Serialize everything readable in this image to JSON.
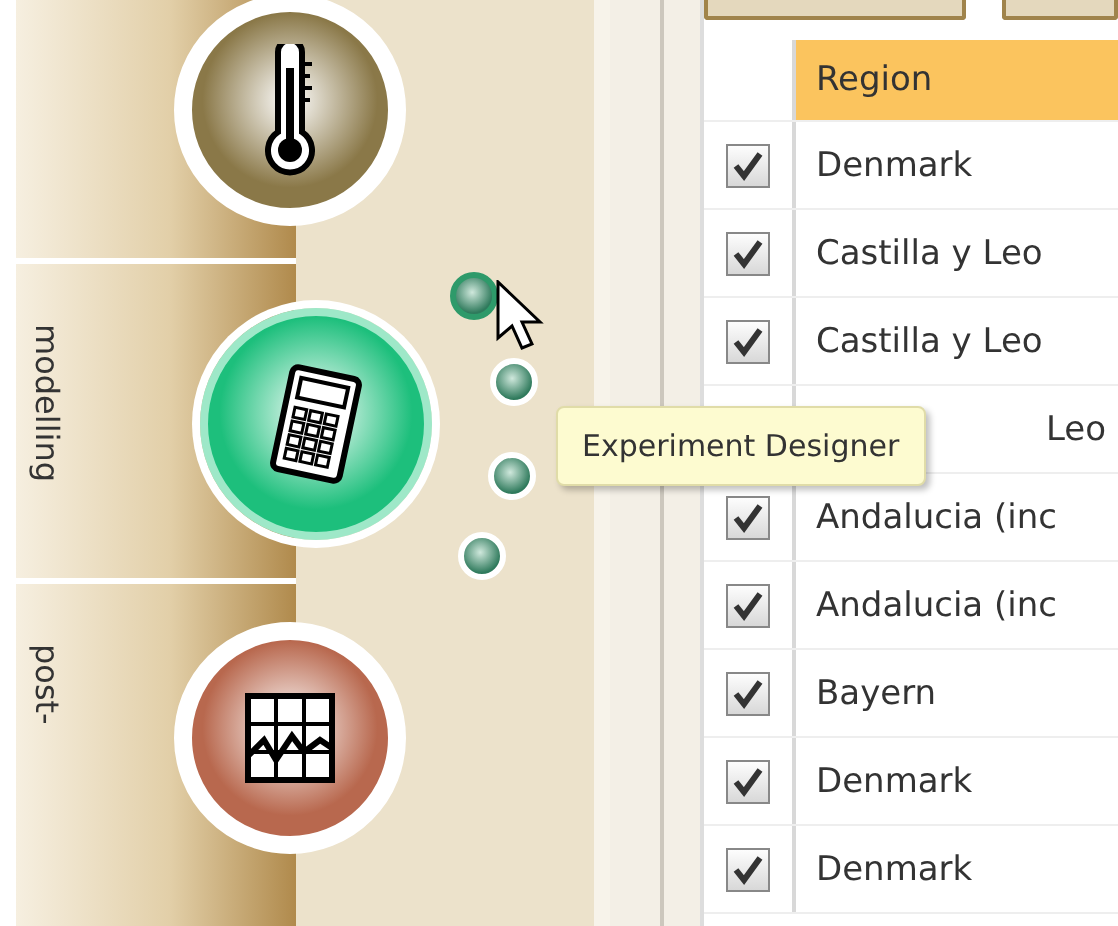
{
  "side_tabs": [
    {
      "label": "modelling"
    },
    {
      "label": "post-"
    }
  ],
  "tools": [
    {
      "kind": "thermometer",
      "active": false,
      "color": "#8a7848"
    },
    {
      "kind": "calculator",
      "active": true,
      "color": "#1dbf7c"
    },
    {
      "kind": "chart",
      "active": false,
      "color": "#b8684e"
    }
  ],
  "sub_menu": [
    {
      "selected": true
    },
    {
      "selected": false
    },
    {
      "selected": false
    },
    {
      "selected": false
    }
  ],
  "tooltip": "Experiment Designer",
  "table": {
    "columns": [
      "Region"
    ],
    "rows": [
      {
        "kind": "row",
        "checked": true,
        "region": "Denmark"
      },
      {
        "kind": "row",
        "checked": true,
        "region": "Castilla y Leo"
      },
      {
        "kind": "row",
        "checked": true,
        "region": "Castilla y Leo"
      },
      {
        "kind": "covered",
        "region": "Leo"
      },
      {
        "kind": "row",
        "checked": true,
        "region": "Andalucia (inc"
      },
      {
        "kind": "row",
        "checked": true,
        "region": "Andalucia (inc"
      },
      {
        "kind": "row",
        "checked": true,
        "region": "Bayern"
      },
      {
        "kind": "row",
        "checked": true,
        "region": "Denmark"
      },
      {
        "kind": "row",
        "checked": true,
        "region": "Denmark"
      }
    ]
  }
}
